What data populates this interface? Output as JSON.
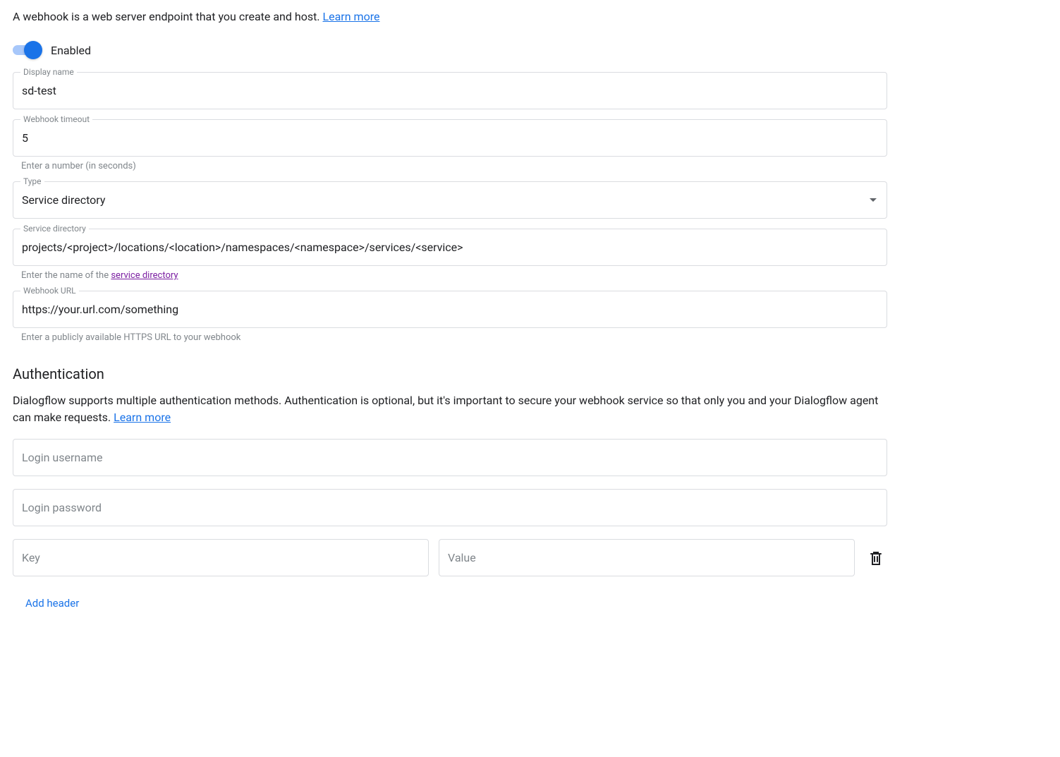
{
  "intro": {
    "text": "A webhook is a web server endpoint that you create and host. ",
    "link": "Learn more"
  },
  "enabled_toggle": {
    "label": "Enabled",
    "value": true
  },
  "display_name": {
    "label": "Display name",
    "value": "sd-test"
  },
  "timeout": {
    "label": "Webhook timeout",
    "value": "5",
    "helper": "Enter a number (in seconds)"
  },
  "type": {
    "label": "Type",
    "value": "Service directory"
  },
  "service_directory": {
    "label": "Service directory",
    "value": "projects/<project>/locations/<location>/namespaces/<namespace>/services/<service>",
    "helper_prefix": "Enter the name of the ",
    "helper_link": "service directory"
  },
  "webhook_url": {
    "label": "Webhook URL",
    "value": "https://your.url.com/something",
    "helper": "Enter a publicly available HTTPS URL to your webhook"
  },
  "auth": {
    "heading": "Authentication",
    "desc": "Dialogflow supports multiple authentication methods. Authentication is optional, but it's important to secure your webhook service so that only you and your Dialogflow agent can make requests. ",
    "link": "Learn more",
    "username_placeholder": "Login username",
    "password_placeholder": "Login password",
    "key_placeholder": "Key",
    "value_placeholder": "Value",
    "add_header_label": "Add header"
  }
}
